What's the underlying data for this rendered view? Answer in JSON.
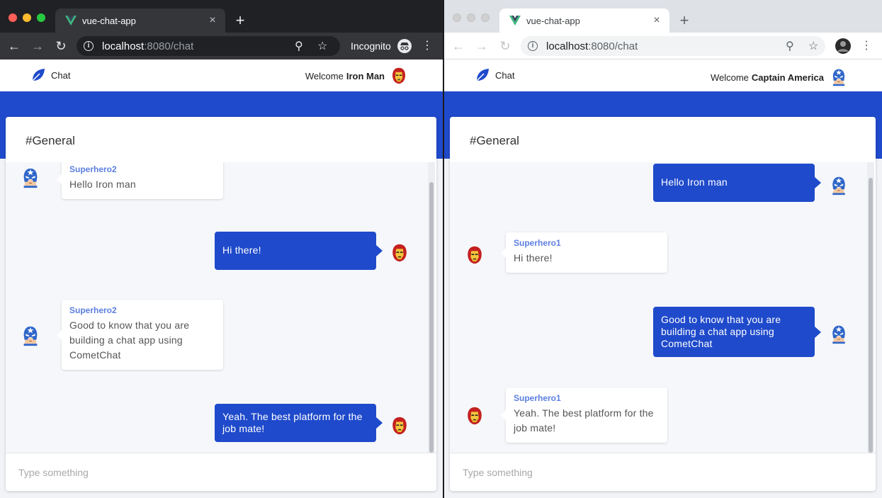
{
  "colors": {
    "brand_blue": "#1f4acb",
    "sender_name": "#5b7fe0",
    "close_red": "#ff5f57",
    "minimize_yellow": "#febc2e",
    "zoom_green": "#28c840"
  },
  "left_window": {
    "tab_title": "vue-chat-app",
    "url_host": "localhost",
    "url_path": ":8080/chat",
    "incognito_label": "Incognito",
    "app": {
      "brand": "Chat",
      "welcome_prefix": "Welcome",
      "user": "Iron Man",
      "user_avatar": "iron-man-icon",
      "channel": "#General",
      "input_placeholder": "Type something",
      "messages": [
        {
          "side": "in",
          "sender": "Superhero2",
          "text": "Hello Iron man",
          "avatar": "captain-america-icon"
        },
        {
          "side": "out",
          "text": "Hi there!",
          "avatar": "iron-man-icon"
        },
        {
          "side": "in",
          "sender": "Superhero2",
          "text": "Good to know that you are building a chat app using CometChat",
          "avatar": "captain-america-icon"
        },
        {
          "side": "out",
          "text": "Yeah. The best platform for the job mate!",
          "avatar": "iron-man-icon"
        }
      ]
    }
  },
  "right_window": {
    "tab_title": "vue-chat-app",
    "url_host": "localhost",
    "url_path": ":8080/chat",
    "app": {
      "brand": "Chat",
      "welcome_prefix": "Welcome",
      "user": "Captain America",
      "user_avatar": "captain-america-icon",
      "channel": "#General",
      "input_placeholder": "Type something",
      "messages": [
        {
          "side": "out",
          "text": "Hello Iron man",
          "avatar": "captain-america-icon"
        },
        {
          "side": "in",
          "sender": "Superhero1",
          "text": "Hi there!",
          "avatar": "iron-man-icon"
        },
        {
          "side": "out",
          "text": "Good to know that you are building a chat app using CometChat",
          "avatar": "captain-america-icon"
        },
        {
          "side": "in",
          "sender": "Superhero1",
          "text": "Yeah. The best platform for the job mate!",
          "avatar": "iron-man-icon"
        }
      ]
    }
  }
}
